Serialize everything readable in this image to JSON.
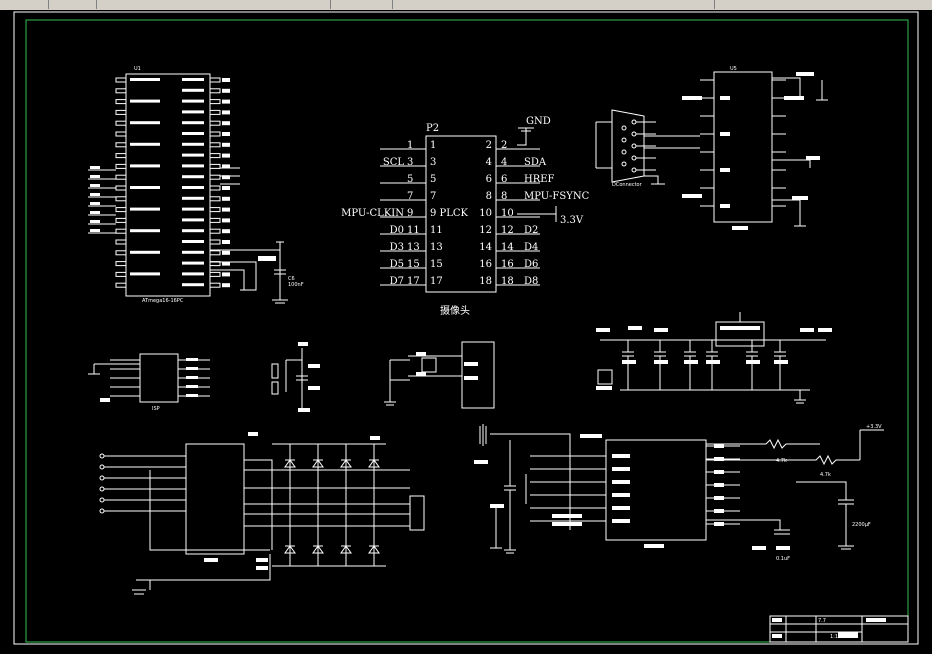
{
  "camera_header": {
    "ref": "P2",
    "caption": "摄像头",
    "gnd": "GND",
    "v33": "3.3V",
    "left_pins": [
      {
        "num": "1",
        "label": ""
      },
      {
        "num": "3",
        "label": "SCL"
      },
      {
        "num": "5",
        "label": ""
      },
      {
        "num": "7",
        "label": ""
      },
      {
        "num": "9",
        "label": "MPU-CLKIN"
      },
      {
        "num": "11",
        "label": "D0"
      },
      {
        "num": "13",
        "label": "D3"
      },
      {
        "num": "15",
        "label": "D5"
      },
      {
        "num": "17",
        "label": "D7"
      }
    ],
    "right_pins": [
      {
        "num": "2",
        "label": ""
      },
      {
        "num": "4",
        "label": "SDA"
      },
      {
        "num": "6",
        "label": "HREF"
      },
      {
        "num": "8",
        "label": "MPU-FSYNC"
      },
      {
        "num": "10",
        "label": ""
      },
      {
        "num": "12",
        "label": "D2"
      },
      {
        "num": "14",
        "label": "D4"
      },
      {
        "num": "16",
        "label": "D6"
      },
      {
        "num": "18",
        "label": "D8"
      }
    ],
    "inner_left": [
      "1",
      "3",
      "5",
      "7",
      "9 PLCK",
      "11",
      "13",
      "15",
      "17"
    ],
    "inner_right": [
      "2",
      "4",
      "6",
      "8",
      "10",
      "12",
      "14",
      "16",
      "18"
    ]
  },
  "mcu": {
    "ref": "U1",
    "part": "ATmega16-16PC",
    "cap_label": "C6",
    "cap_value": "100nF"
  },
  "serial": {
    "ref": "U5",
    "connector": "DConnector"
  },
  "small_labels": {
    "isp": "ISP",
    "r1": "4.7k",
    "r2": "4.7k",
    "c_big": "2200μF",
    "c_small": "0.1uF",
    "vout": "+3.3V"
  },
  "title_block": {
    "r1": "7.7",
    "r2": "1:1"
  }
}
